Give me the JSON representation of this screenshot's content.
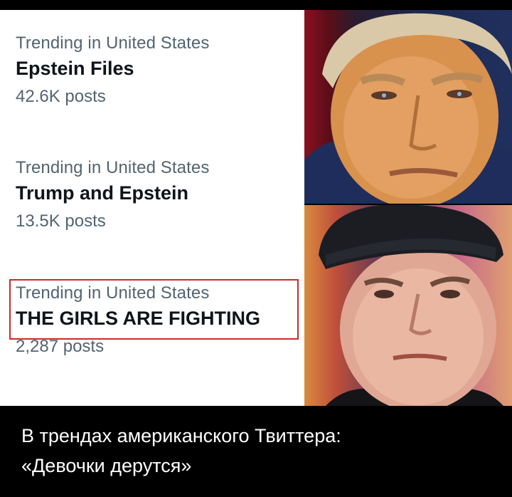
{
  "trends": [
    {
      "context": "Trending in United States",
      "name": "Epstein Files",
      "posts": "42.6K posts"
    },
    {
      "context": "Trending in United States",
      "name": "Trump and Epstein",
      "posts": "13.5K posts"
    },
    {
      "context": "Trending in United States",
      "name": "THE GIRLS ARE FIGHTING",
      "posts": "2,287 posts",
      "highlighted": true
    }
  ],
  "highlight_color": "#cf2a2a",
  "photos": [
    {
      "icon": "portrait-photo-man-suit"
    },
    {
      "icon": "portrait-photo-man-cap"
    }
  ],
  "caption": {
    "line1": "В трендах американского Твиттера:",
    "line2": "«Девочки дерутся»"
  }
}
